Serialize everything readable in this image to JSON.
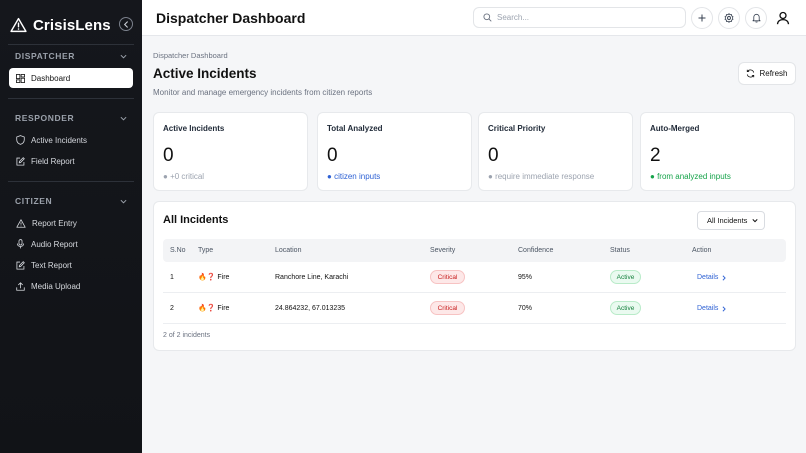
{
  "app": {
    "name": "CrisisLens"
  },
  "sidebar": {
    "sections": [
      {
        "title": "DISPATCHER",
        "items": [
          {
            "label": "Dashboard",
            "icon": "grid-icon",
            "active": true
          }
        ]
      },
      {
        "title": "RESPONDER",
        "items": [
          {
            "label": "Active Incidents",
            "icon": "shield-icon"
          },
          {
            "label": "Field Report",
            "icon": "edit-icon"
          }
        ]
      },
      {
        "title": "CITIZEN",
        "items": [
          {
            "label": "Report Entry",
            "icon": "alert-triangle-icon"
          },
          {
            "label": "Audio Report",
            "icon": "microphone-icon"
          },
          {
            "label": "Text Report",
            "icon": "edit-icon"
          },
          {
            "label": "Media Upload",
            "icon": "upload-icon"
          }
        ]
      }
    ]
  },
  "header": {
    "title": "Dispatcher Dashboard",
    "search_placeholder": "Search...",
    "buttons": [
      "plus-icon",
      "gear-icon",
      "bell-icon",
      "user-icon"
    ]
  },
  "main": {
    "breadcrumb": "Dispatcher Dashboard",
    "title": "Active Incidents",
    "subtitle": "Monitor and manage emergency incidents from citizen reports",
    "refresh_label": "Refresh"
  },
  "stats": [
    {
      "label": "Active Incidents",
      "value": "0",
      "foot": "+0 critical",
      "color": "#9ca3af"
    },
    {
      "label": "Total Analyzed",
      "value": "0",
      "foot": "citizen inputs",
      "color": "#2f62d4"
    },
    {
      "label": "Critical Priority",
      "value": "0",
      "foot": "require immediate response",
      "color": "#9ca3af"
    },
    {
      "label": "Auto-Merged",
      "value": "2",
      "foot": "from analyzed inputs",
      "color": "#16a34a"
    }
  ],
  "incidents": {
    "title": "All Incidents",
    "filter_value": "All Incidents",
    "columns": [
      "S.No",
      "Type",
      "Location",
      "Severity",
      "Confidence",
      "Status",
      "Action"
    ],
    "rows": [
      {
        "sno": "1",
        "type_icon": "🔥❓",
        "type": "Fire",
        "location": "Ranchore Line, Karachi",
        "severity": "Critical",
        "confidence": "95%",
        "status": "Active",
        "action": "Details"
      },
      {
        "sno": "2",
        "type_icon": "🔥❓",
        "type": "Fire",
        "location": "24.864232, 67.013235",
        "severity": "Critical",
        "confidence": "70%",
        "status": "Active",
        "action": "Details"
      }
    ],
    "footer": "2 of 2 incidents"
  },
  "colors": {
    "sidebar_bg": "#15171c",
    "accent_blue": "#2f62d4",
    "critical_red": "#c81e1e",
    "active_green": "#15803d"
  }
}
